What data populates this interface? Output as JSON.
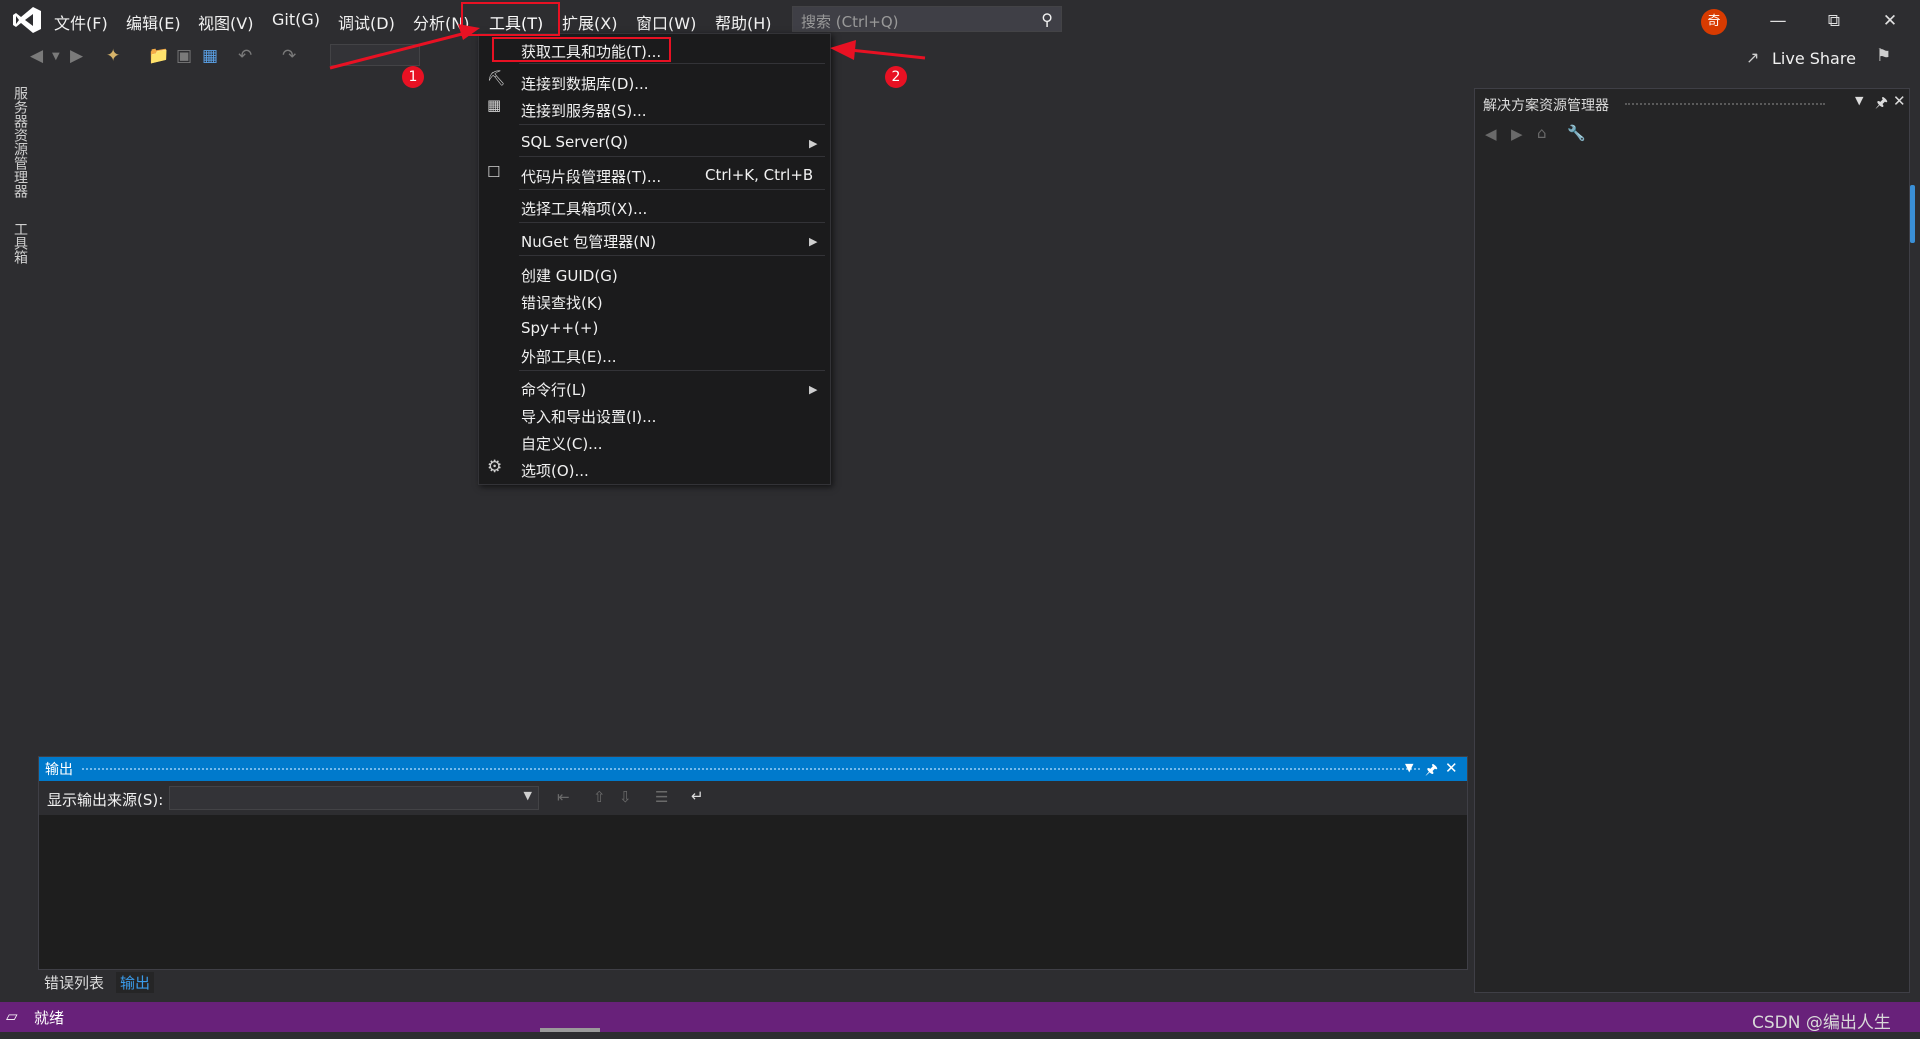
{
  "menubar": {
    "items": [
      "文件(F)",
      "编辑(E)",
      "视图(V)",
      "Git(G)",
      "调试(D)",
      "分析(N)",
      "工具(T)",
      "扩展(X)",
      "窗口(W)",
      "帮助(H)"
    ],
    "search_placeholder": "搜索 (Ctrl+Q)",
    "avatar_initial": "奇"
  },
  "toolbar": {
    "live_share": "Live Share"
  },
  "left_vertical_tabs": [
    "服务器资源管理器",
    "工具箱"
  ],
  "tools_menu": {
    "items": [
      {
        "label": "获取工具和功能(T)..."
      },
      {
        "label": "连接到数据库(D)..."
      },
      {
        "label": "连接到服务器(S)..."
      },
      {
        "label": "SQL Server(Q)",
        "submenu": true
      },
      {
        "label": "代码片段管理器(T)...",
        "shortcut": "Ctrl+K, Ctrl+B"
      },
      {
        "label": "选择工具箱项(X)..."
      },
      {
        "label": "NuGet 包管理器(N)",
        "submenu": true
      },
      {
        "label": "创建 GUID(G)"
      },
      {
        "label": "错误查找(K)"
      },
      {
        "label": "Spy++(+)"
      },
      {
        "label": "外部工具(E)..."
      },
      {
        "label": "命令行(L)",
        "submenu": true
      },
      {
        "label": "导入和导出设置(I)..."
      },
      {
        "label": "自定义(C)..."
      },
      {
        "label": "选项(O)..."
      }
    ]
  },
  "annotations": {
    "badge1": "1",
    "badge2": "2"
  },
  "solution_explorer": {
    "title": "解决方案资源管理器"
  },
  "output_panel": {
    "title": "输出",
    "source_label": "显示输出来源(S):",
    "source_value": ""
  },
  "bottom_tabs": [
    "错误列表",
    "输出"
  ],
  "statusbar": {
    "text": "就绪"
  },
  "watermark": "CSDN @编出人生",
  "colors": {
    "statusbar": "#68217a",
    "accent": "#007acc",
    "annotation_red": "#e81123"
  }
}
